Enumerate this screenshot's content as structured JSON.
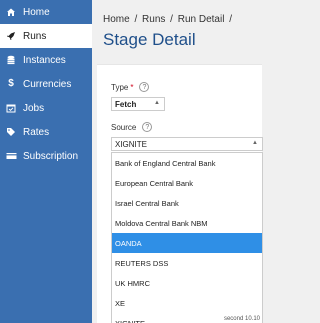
{
  "sidebar": {
    "items": [
      {
        "label": "Home",
        "icon": "home-icon"
      },
      {
        "label": "Runs",
        "icon": "rocket-icon"
      },
      {
        "label": "Instances",
        "icon": "database-icon"
      },
      {
        "label": "Currencies",
        "icon": "dollar-icon"
      },
      {
        "label": "Jobs",
        "icon": "calendar-check-icon"
      },
      {
        "label": "Rates",
        "icon": "tag-icon"
      },
      {
        "label": "Subscription",
        "icon": "card-icon"
      }
    ],
    "active_index": 1,
    "color": "#3a6fb0"
  },
  "breadcrumb": {
    "items": [
      "Home",
      "/",
      "Runs",
      "/",
      "Run Detail",
      "/"
    ]
  },
  "page": {
    "title": "Stage Detail"
  },
  "form": {
    "type_label": "Type",
    "type_required_mark": "*",
    "type_value": "Fetch",
    "source_label": "Source",
    "source_value": "XIGNITE",
    "help_glyph": "?",
    "source_options": [
      "Bank of England Central Bank",
      "European Central Bank",
      "Israel Central Bank",
      "Moldova Central Bank NBM",
      "OANDA",
      "REUTERS DSS",
      "UK HMRC",
      "XE",
      "XIGNITE"
    ],
    "highlighted_option": "OANDA",
    "highlight_color": "#2f8fe6"
  },
  "footer": {
    "text": "second 10.10"
  }
}
